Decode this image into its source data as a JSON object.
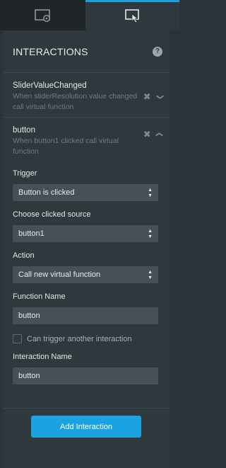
{
  "tabs": [
    {
      "icon": "screen-settings-icon",
      "active": false
    },
    {
      "icon": "screen-touch-icon",
      "active": true
    }
  ],
  "header": {
    "title": "INTERACTIONS",
    "help_icon": "help-icon"
  },
  "interactions": [
    {
      "title": "SliderValueChanged",
      "description": "When sliderResolution value changed call virtual function",
      "expanded": false
    },
    {
      "title": "button",
      "description": "When button1 clicked call virtual function",
      "expanded": true
    }
  ],
  "editor": {
    "trigger_label": "Trigger",
    "trigger_value": "Button is clicked",
    "source_label": "Choose clicked source",
    "source_value": "button1",
    "action_label": "Action",
    "action_value": "Call new virtual function",
    "function_name_label": "Function Name",
    "function_name_value": "button",
    "chain_label": "Can trigger another interaction",
    "chain_checked": false,
    "interaction_name_label": "Interaction Name",
    "interaction_name_value": "button"
  },
  "add_button_label": "Add Interaction",
  "colors": {
    "accent": "#1aa3e0",
    "panel": "#2f383d",
    "control": "#465157"
  }
}
